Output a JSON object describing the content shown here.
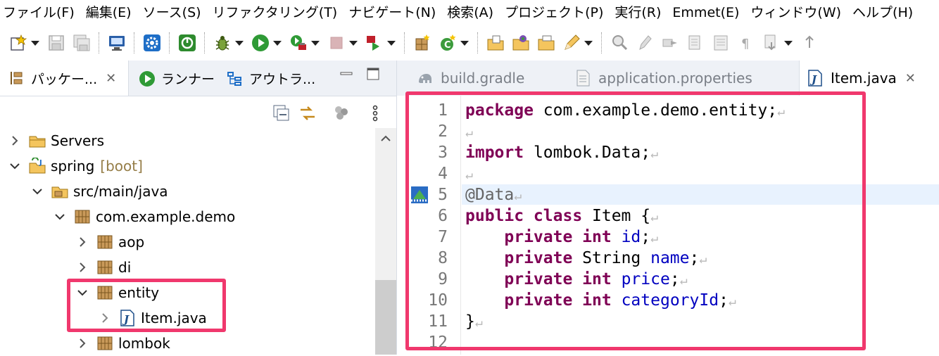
{
  "menu": [
    "ファイル(F)",
    "編集(E)",
    "ソース(S)",
    "リファクタリング(T)",
    "ナビゲート(N)",
    "検索(A)",
    "プロジェクト(P)",
    "実行(R)",
    "Emmet(E)",
    "ウィンドウ(W)",
    "ヘルプ(H)"
  ],
  "left_panel": {
    "tabs": [
      {
        "label": "パッケー...",
        "close": "✕"
      },
      {
        "label": "ランナー"
      },
      {
        "label": "アウトラ..."
      }
    ],
    "tree": [
      {
        "label": "Servers",
        "decoration": "",
        "expanded": false
      },
      {
        "label": "spring",
        "decoration": "[boot]",
        "expanded": true
      },
      {
        "label": "src/main/java",
        "decoration": "",
        "expanded": true
      },
      {
        "label": "com.example.demo",
        "decoration": "",
        "expanded": true
      },
      {
        "label": "aop",
        "decoration": "",
        "expanded": false
      },
      {
        "label": "di",
        "decoration": "",
        "expanded": false
      },
      {
        "label": "entity",
        "decoration": "",
        "expanded": true
      },
      {
        "label": "Item.java",
        "decoration": "",
        "expanded": false
      },
      {
        "label": "lombok",
        "decoration": "",
        "expanded": false
      }
    ]
  },
  "editor": {
    "tabs": [
      {
        "label": "build.gradle"
      },
      {
        "label": "application.properties"
      },
      {
        "label": "Item.java",
        "close": "✕"
      }
    ],
    "line_numbers": [
      "1",
      "2",
      "3",
      "4",
      "5",
      "6",
      "7",
      "8",
      "9",
      "10",
      "11",
      "12"
    ],
    "code": {
      "l1_kw": "package",
      "l1_rest": " com.example.demo.entity;",
      "l3_kw": "import",
      "l3_rest": " lombok.Data;",
      "l5_ann": "@Data",
      "l6_kw": "public class",
      "l6_rest": " Item {",
      "l7_kw": "private int",
      "l7_field": "id",
      "l7_end": ";",
      "l8_kw": "private",
      "l8_type": " String ",
      "l8_field": "name",
      "l8_end": ";",
      "l9_kw": "private int",
      "l9_field": "price",
      "l9_end": ";",
      "l10_kw": "private int",
      "l10_field": "categoryId",
      "l10_end": ";",
      "l11": "}"
    },
    "eol_mark": "↵"
  },
  "colors": {
    "highlight_box": "#f0386d",
    "keyword": "#7f0055",
    "field": "#0000c0",
    "annotation": "#646464"
  }
}
